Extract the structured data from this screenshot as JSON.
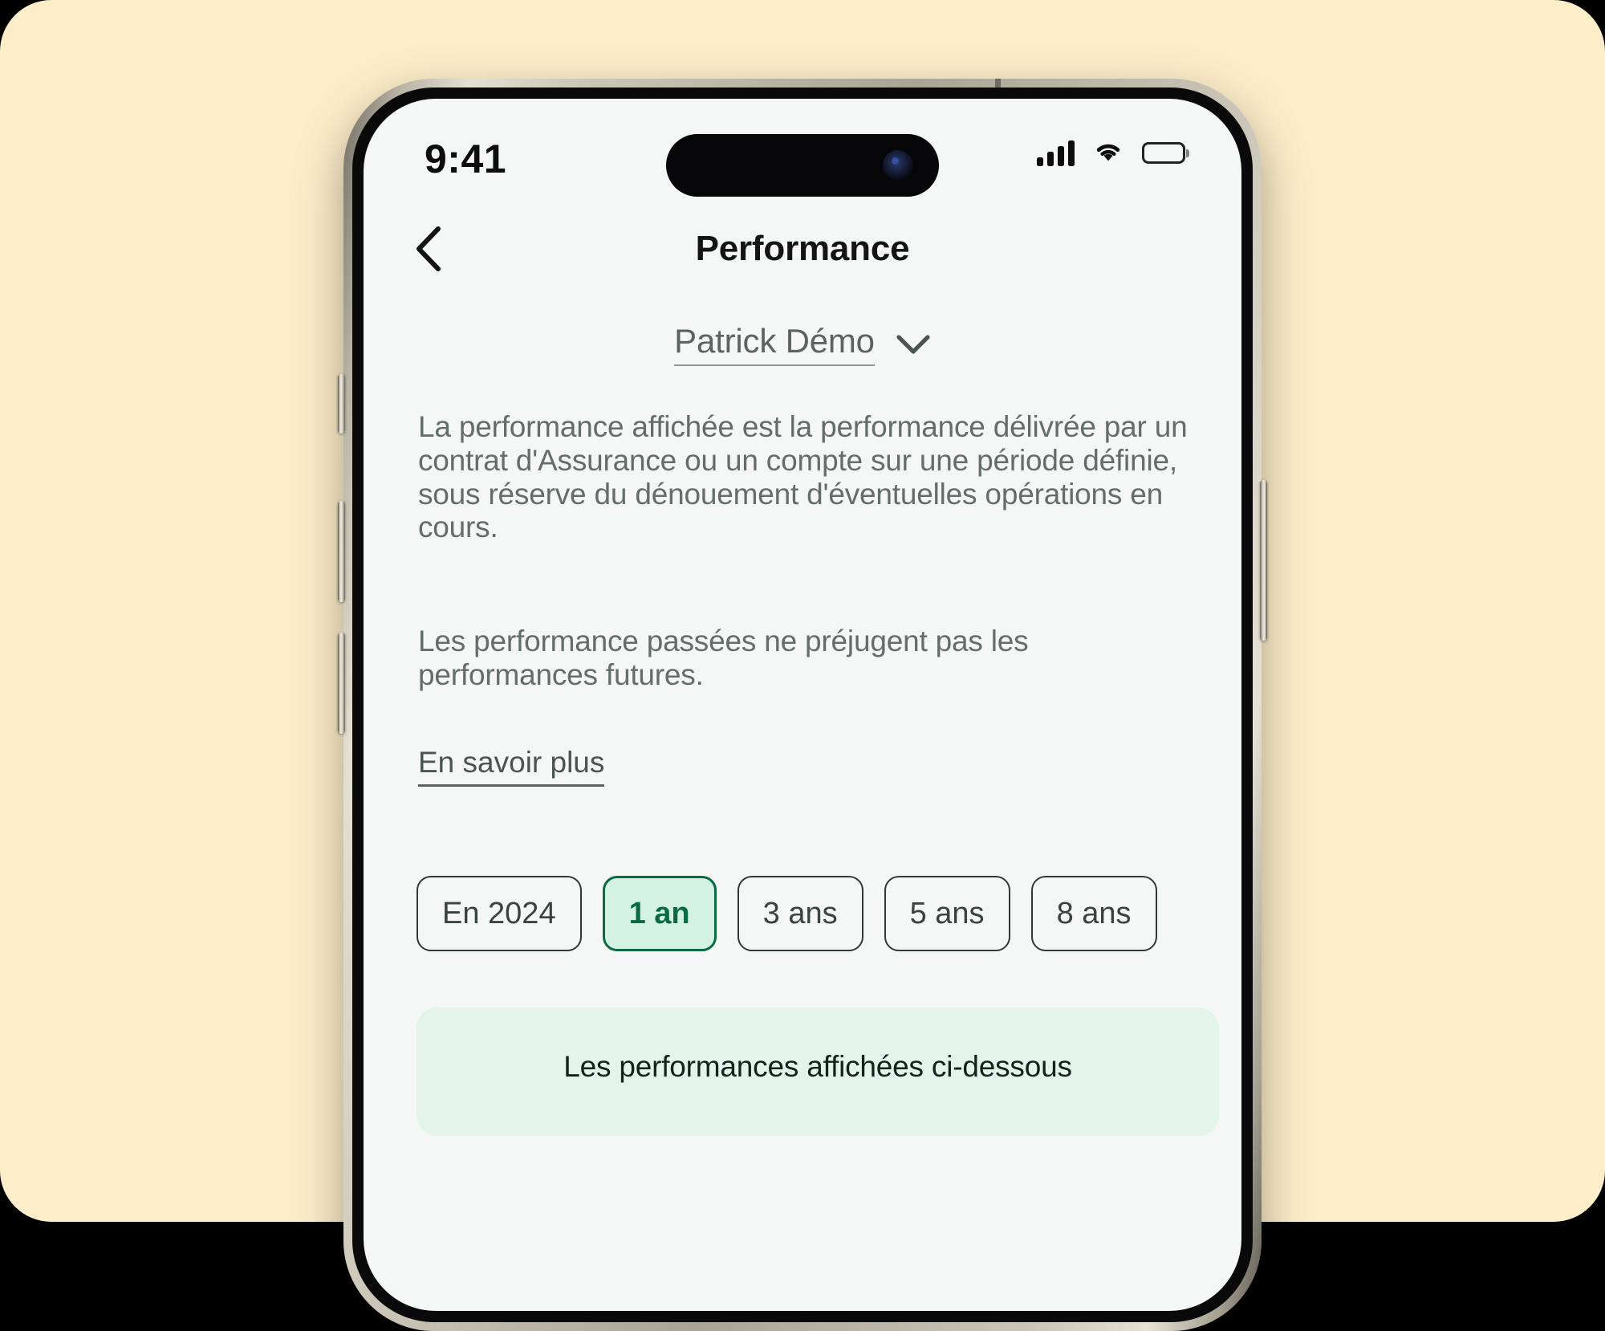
{
  "theme": {
    "backdrop_color": "#fdeec9",
    "screen_bg": "#f5f6f6",
    "accent_green": "#0a6b43",
    "chip_selected_bg": "#d4f2e2",
    "banner_bg": "#e4f4ea",
    "body_text_color": "#636e6c"
  },
  "status_bar": {
    "time": "9:41",
    "signal_icon": "cellular-signal-icon",
    "wifi_icon": "wifi-icon",
    "battery_icon": "battery-full-icon"
  },
  "nav": {
    "back_icon": "chevron-left-icon",
    "title": "Performance"
  },
  "account": {
    "name": "Patrick Démo",
    "dropdown_icon": "chevron-down-icon"
  },
  "main": {
    "paragraphs": [
      "La performance affichée est la performance délivrée par un contrat d'Assurance ou un compte sur une période définie, sous réserve du dénouement d'éventuelles opérations en cours.",
      "Les performance passées ne préjugent pas les performances futures."
    ],
    "learn_more_label": "En savoir plus",
    "period_chips": [
      {
        "label": "En 2024",
        "selected": false
      },
      {
        "label": "1 an",
        "selected": true
      },
      {
        "label": "3 ans",
        "selected": false
      },
      {
        "label": "5 ans",
        "selected": false
      },
      {
        "label": "8 ans",
        "selected": false
      }
    ],
    "banner_text": "Les performances affichées ci-dessous"
  }
}
